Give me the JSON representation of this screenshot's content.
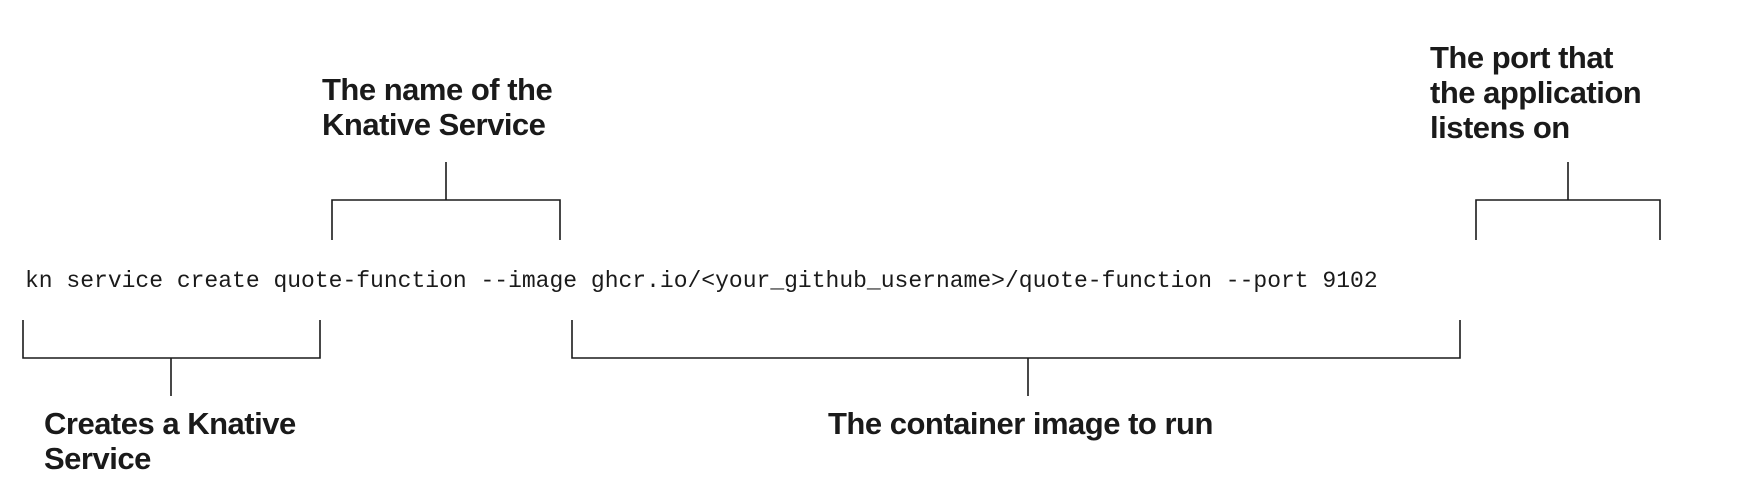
{
  "command": {
    "text": "kn service create quote-function --image ghcr.io/<your_github_username>/quote-function --port 9102"
  },
  "annotations": {
    "service_name": {
      "lines": [
        "The name of the",
        "Knative Service"
      ]
    },
    "port": {
      "lines": [
        "The port that",
        "the application",
        "listens on"
      ]
    },
    "create": {
      "lines": [
        "Creates a Knative",
        "Service"
      ]
    },
    "image": {
      "lines": [
        "The container image to run"
      ]
    }
  }
}
